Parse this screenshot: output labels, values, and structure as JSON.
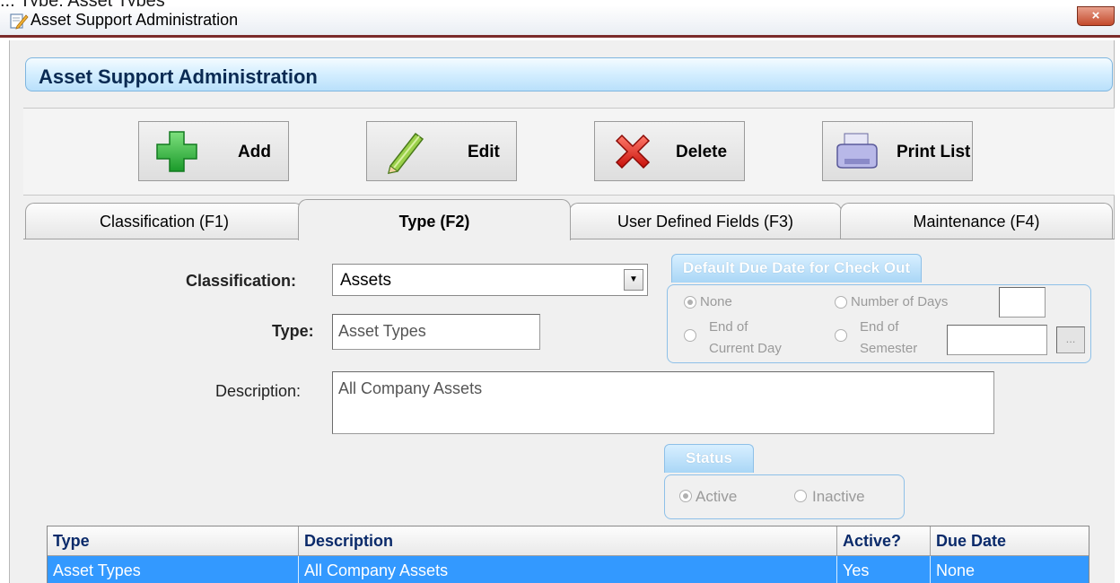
{
  "top_text": "...  Type: Asset Types",
  "window": {
    "title": "Asset Support Administration",
    "close_glyph": "×"
  },
  "header": {
    "title": "Asset Support Administration"
  },
  "toolbar": {
    "add_label": "Add",
    "edit_label": "Edit",
    "delete_label": "Delete",
    "print_label": "Print List"
  },
  "tabs": [
    {
      "label": "Classification (F1)"
    },
    {
      "label": "Type (F2)"
    },
    {
      "label": "User Defined Fields (F3)"
    },
    {
      "label": "Maintenance (F4)"
    }
  ],
  "form": {
    "classification_label": "Classification:",
    "classification_value": "Assets",
    "type_label": "Type:",
    "type_value": "Asset Types",
    "description_label": "Description:",
    "description_value": "All Company Assets"
  },
  "due_date_group": {
    "title": "Default Due Date for Check Out",
    "options": [
      {
        "label": "None",
        "selected": true
      },
      {
        "label": "Number of Days",
        "selected": false
      },
      {
        "label": "End of Current Day",
        "selected": false
      },
      {
        "label": "End of Semester",
        "selected": false
      }
    ],
    "none_label": "None",
    "days_label": "Number of Days",
    "eod_label1": "End of",
    "eod_label2": "Current Day",
    "eos_label1": "End of",
    "eos_label2": "Semester",
    "browse_label": "..."
  },
  "status_group": {
    "title": "Status",
    "active_label": "Active",
    "inactive_label": "Inactive",
    "selected": "Active"
  },
  "grid": {
    "columns": [
      "Type",
      "Description",
      "Active?",
      "Due Date"
    ],
    "rows": [
      {
        "type": "Asset Types",
        "description": "All Company Assets",
        "active": "Yes",
        "due_date": "None",
        "selected": true
      }
    ]
  },
  "colors": {
    "accent": "#3399ff",
    "header_text": "#0a2a52",
    "titlebar_border": "#7b2c2c",
    "close_button": "#c34a2c",
    "add_icon": "#22b14c",
    "delete_icon": "#e0201a"
  }
}
